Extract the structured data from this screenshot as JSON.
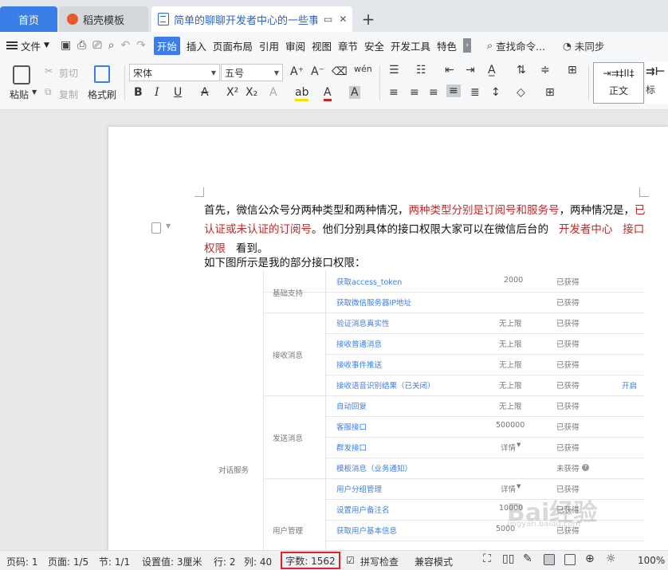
{
  "tabs": {
    "home": "首页",
    "template": "稻壳模板",
    "document": "简单的聊聊开发者中心的一些事",
    "add": "+"
  },
  "menu": {
    "file": "文件",
    "items": [
      "开始",
      "插入",
      "页面布局",
      "引用",
      "审阅",
      "视图",
      "章节",
      "安全",
      "开发工具",
      "特色"
    ],
    "search": "查找命令...",
    "sync": "未同步"
  },
  "ribbon": {
    "paste": "粘贴",
    "cut": "剪切",
    "copy": "复制",
    "format_painter": "格式刷",
    "font_name": "宋体",
    "font_size": "五号",
    "style_normal": "正文",
    "style_heading": "标"
  },
  "document": {
    "para1_a": "首先，微信公众号分两种类型和两种情况，",
    "para1_red1": "两种类型分别是订阅号和服务号",
    "para1_b": "，两种情况是，",
    "para1_red2": "已认证或未认证的订阅号",
    "para1_c": "。他们分别具体的接口权限大家可以在微信后台的",
    "para1_red3": "开发者中心",
    "para1_red4": "接口权限",
    "para1_d": "看到。",
    "para2": "如下图所示是我的部分接口权限："
  },
  "permissions_table": {
    "categories": [
      "对话服务"
    ],
    "groups": [
      "基础支持",
      "接收消息",
      "发送消息",
      "用户管理"
    ],
    "rows": [
      {
        "name": "获取access_token",
        "limit": "2000",
        "status": "已获得",
        "extra": ""
      },
      {
        "name": "获取微信服务器IP地址",
        "limit": "",
        "status": "已获得",
        "extra": ""
      },
      {
        "name": "验证消息真实性",
        "limit": "无上限",
        "status": "已获得",
        "extra": ""
      },
      {
        "name": "接收普通消息",
        "limit": "无上限",
        "status": "已获得",
        "extra": ""
      },
      {
        "name": "接收事件推送",
        "limit": "无上限",
        "status": "已获得",
        "extra": ""
      },
      {
        "name": "接收语音识别结果（已关闭）",
        "limit": "无上限",
        "status": "已获得",
        "extra": "开启"
      },
      {
        "name": "自动回复",
        "limit": "无上限",
        "status": "已获得",
        "extra": ""
      },
      {
        "name": "客服接口",
        "limit": "500000",
        "status": "已获得",
        "extra": ""
      },
      {
        "name": "群发接口",
        "limit": "详情",
        "status": "已获得",
        "extra": ""
      },
      {
        "name": "模板消息（业务通知）",
        "limit": "",
        "status": "未获得",
        "extra": ""
      },
      {
        "name": "用户分组管理",
        "limit": "详情",
        "status": "已获得",
        "extra": ""
      },
      {
        "name": "设置用户备注名",
        "limit": "10000",
        "status": "已获得",
        "extra": ""
      },
      {
        "name": "获取用户基本信息",
        "limit": "5000",
        "status": "已获得",
        "extra": ""
      }
    ],
    "watermark": "Bai经验",
    "watermark_sub": "jingyan.baidu.com"
  },
  "status": {
    "page_no": "页码: 1",
    "pages": "页面: 1/5",
    "section": "节: 1/1",
    "setting": "设置值: 3厘米",
    "row": "行: 2",
    "col": "列: 40",
    "word_count": "字数: 1562",
    "spell": "拼写检查",
    "compat": "兼容模式",
    "zoom": "100%"
  }
}
